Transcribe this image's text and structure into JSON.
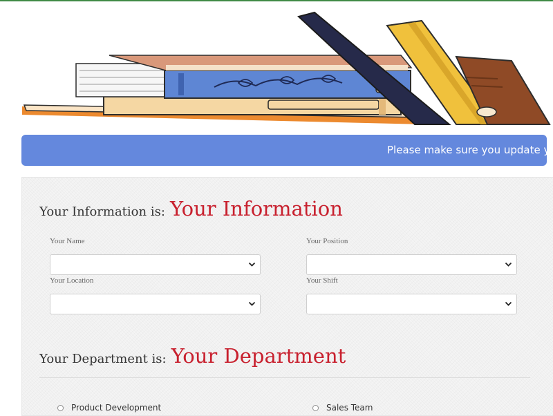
{
  "notice": {
    "text": "Please make sure you update you"
  },
  "information": {
    "heading_prefix": "Your Information is:",
    "heading_value": "Your Information",
    "fields": [
      {
        "label": "Your Name",
        "value": ""
      },
      {
        "label": "Your Position",
        "value": ""
      },
      {
        "label": "Your Location",
        "value": ""
      },
      {
        "label": "Your Shift",
        "value": ""
      }
    ]
  },
  "department": {
    "heading_prefix": "Your Department is:",
    "heading_value": "Your Department",
    "options": [
      {
        "label": "Product Development",
        "checked": false
      },
      {
        "label": "Sales Team",
        "checked": false
      }
    ]
  },
  "colors": {
    "accent_red": "#c8202e",
    "notice_blue": "#6488dd",
    "top_line_green": "#3f8a45"
  }
}
